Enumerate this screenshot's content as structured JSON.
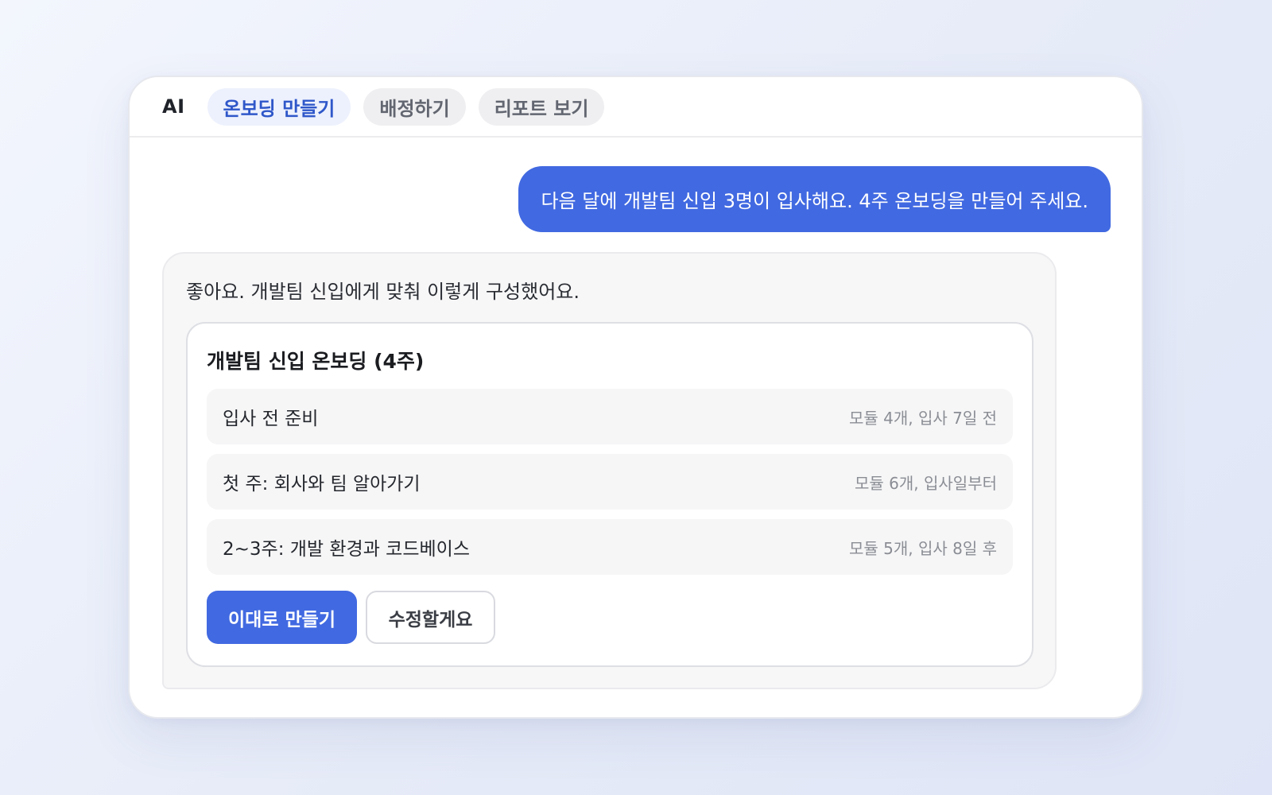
{
  "header": {
    "brand": "AI",
    "tabs": [
      {
        "label": "온보딩 만들기",
        "active": true
      },
      {
        "label": "배정하기",
        "active": false
      },
      {
        "label": "리포트 보기",
        "active": false
      }
    ]
  },
  "conversation": {
    "user_message": "다음 달에 개발팀 신입 3명이 입사해요. 4주 온보딩을 만들어 주세요.",
    "ai_message": "좋아요. 개발팀 신입에게 맞춰 이렇게 구성했어요.",
    "plan": {
      "title": "개발팀 신입 온보딩 (4주)",
      "rows": [
        {
          "label": "입사 전 준비",
          "meta": "모듈 4개, 입사 7일 전"
        },
        {
          "label": "첫 주: 회사와 팀 알아가기",
          "meta": "모듈 6개, 입사일부터"
        },
        {
          "label": "2~3주: 개발 환경과 코드베이스",
          "meta": "모듈 5개, 입사 8일 후"
        }
      ],
      "primary_button": "이대로 만들기",
      "secondary_button": "수정할게요"
    }
  },
  "colors": {
    "accent": "#4169e1",
    "active_tab_text": "#2f57c9",
    "active_tab_bg": "#edf1fd"
  }
}
